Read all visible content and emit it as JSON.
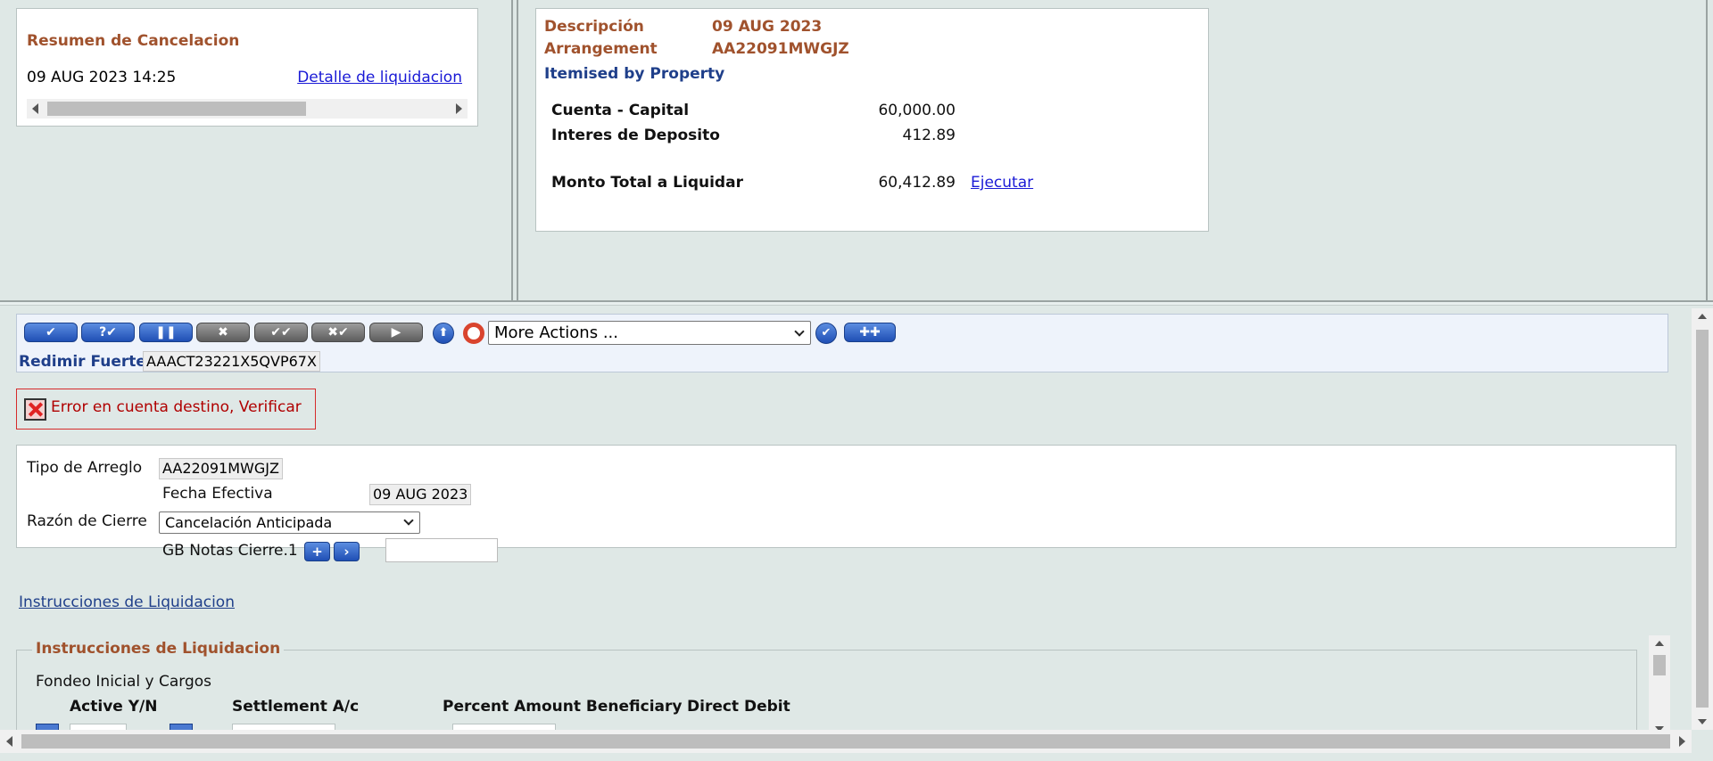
{
  "summary": {
    "title": "Resumen de Cancelacion",
    "datetime": "09 AUG 2023 14:25",
    "link": "Detalle de liquidacion"
  },
  "detail": {
    "descripcion_label": "Descripción",
    "descripcion_value": "09 AUG 2023",
    "arrangement_label": "Arrangement",
    "arrangement_value": "AA22091MWGJZ",
    "itemised": "Itemised by Property",
    "rows": [
      {
        "label": "Cuenta - Capital",
        "value": "60,000.00"
      },
      {
        "label": "Interes de Deposito",
        "value": "412.89"
      }
    ],
    "total_label": "Monto Total a Liquidar",
    "total_value": "60,412.89",
    "execute_link": "Ejecutar"
  },
  "toolbar": {
    "more_actions": "More Actions ...",
    "txn_label": "Redimir Fuerte",
    "txn_id": "AAACT23221X5QVP67X"
  },
  "error": {
    "message": "Error en cuenta destino, Verificar"
  },
  "form": {
    "tipo_label": "Tipo de Arreglo",
    "tipo_value": "AA22091MWGJZ",
    "fecha_label": "Fecha Efectiva",
    "fecha_value": "09 AUG 2023",
    "razon_label": "Razón de Cierre",
    "razon_value": "Cancelación Anticipada",
    "notas_label": "GB Notas Cierre.1"
  },
  "liquidation": {
    "link": "Instrucciones de Liquidacion",
    "legend": "Instrucciones de Liquidacion",
    "subheading": "Fondeo Inicial y Cargos",
    "columns": [
      "Active Y/N",
      "Settlement A/c",
      "Percent Amount Beneficiary",
      "Direct Debit"
    ]
  },
  "colors": {
    "accent_brown": "#a0522d",
    "accent_navy": "#1f3f8a",
    "error_red": "#b00000",
    "button_blue": "#1f4fb5"
  }
}
